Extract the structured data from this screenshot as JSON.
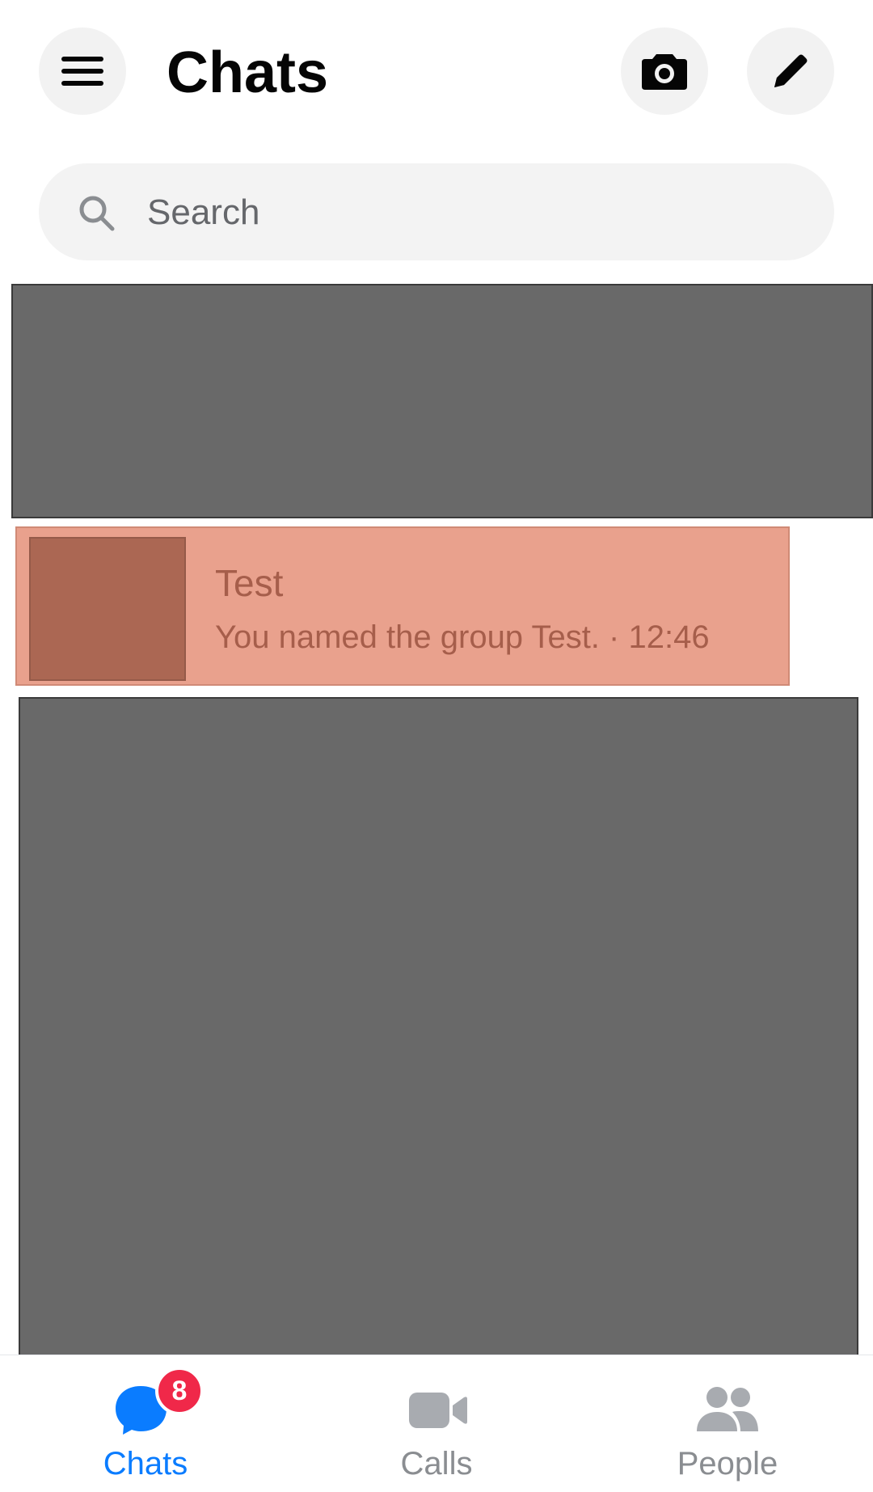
{
  "header": {
    "title": "Chats",
    "menu_icon": "hamburger-menu-icon",
    "camera_icon": "camera-icon",
    "edit_icon": "pencil-icon"
  },
  "search": {
    "placeholder": "Search",
    "icon": "search-icon"
  },
  "chats": [
    {
      "name": "Test",
      "preview": "You named the group Test. · 12:46",
      "highlighted": true
    }
  ],
  "bottom_nav": {
    "tabs": [
      {
        "label": "Chats",
        "icon": "chat-bubble-icon",
        "active": true,
        "badge": "8"
      },
      {
        "label": "Calls",
        "icon": "video-camera-icon",
        "active": false
      },
      {
        "label": "People",
        "icon": "people-icon",
        "active": false
      }
    ]
  },
  "colors": {
    "accent": "#0a7cff",
    "badge": "#f02849",
    "highlight": "#e9a18d",
    "inactive": "#8a8d91",
    "redacted": "#696969"
  }
}
